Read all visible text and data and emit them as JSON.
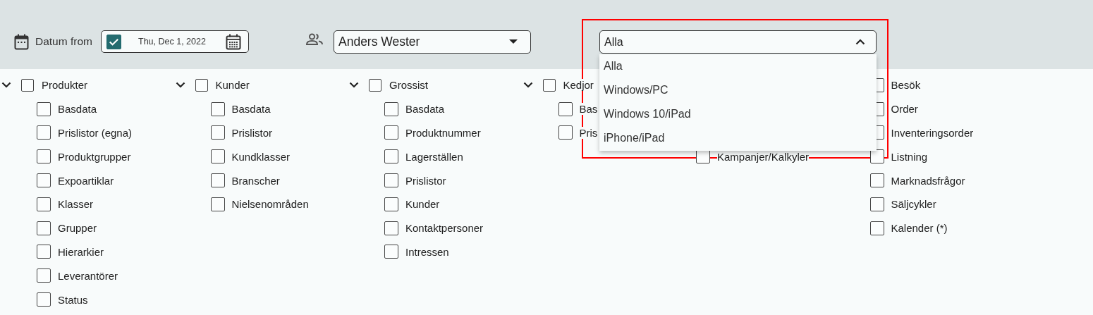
{
  "filters": {
    "date": {
      "label": "Datum from",
      "checked": true,
      "value": "Thu, Dec 1, 2022"
    },
    "person": {
      "value": "Anders Wester"
    },
    "platform": {
      "value": "Alla",
      "expanded": true,
      "options": [
        "Alla",
        "Windows/PC",
        "Windows 10/iPad",
        "iPhone/iPad"
      ]
    }
  },
  "columns": [
    {
      "kind": "group",
      "label": "Produkter",
      "expanded": true,
      "checked": false,
      "items": [
        {
          "label": "Basdata",
          "checked": false
        },
        {
          "label": "Prislistor (egna)",
          "checked": false
        },
        {
          "label": "Produktgrupper",
          "checked": false
        },
        {
          "label": "Expoartiklar",
          "checked": false
        },
        {
          "label": "Klasser",
          "checked": false
        },
        {
          "label": "Grupper",
          "checked": false
        },
        {
          "label": "Hierarkier",
          "checked": false
        },
        {
          "label": "Leverantörer",
          "checked": false
        },
        {
          "label": "Status",
          "checked": false
        }
      ]
    },
    {
      "kind": "group",
      "label": "Kunder",
      "expanded": true,
      "checked": false,
      "items": [
        {
          "label": "Basdata",
          "checked": false
        },
        {
          "label": "Prislistor",
          "checked": false
        },
        {
          "label": "Kundklasser",
          "checked": false
        },
        {
          "label": "Branscher",
          "checked": false
        },
        {
          "label": "Nielsenområden",
          "checked": false
        }
      ]
    },
    {
      "kind": "group",
      "label": "Grossist",
      "expanded": true,
      "checked": false,
      "items": [
        {
          "label": "Basdata",
          "checked": false
        },
        {
          "label": "Produktnummer",
          "checked": false
        },
        {
          "label": "Lagerställen",
          "checked": false
        },
        {
          "label": "Prislistor",
          "checked": false
        },
        {
          "label": "Kunder",
          "checked": false
        },
        {
          "label": "Kontaktpersoner",
          "checked": false
        },
        {
          "label": "Intressen",
          "checked": false
        }
      ]
    },
    {
      "kind": "group",
      "label": "Kedjor",
      "expanded": true,
      "checked": false,
      "items": [
        {
          "label": "Bas",
          "checked": false
        },
        {
          "label": "Pris",
          "checked": false
        }
      ]
    },
    {
      "kind": "list",
      "items": [
        {
          "label": "Kampanjer/Kalkyler",
          "checked": false
        }
      ]
    },
    {
      "kind": "list",
      "items": [
        {
          "label": "Besök",
          "checked": false
        },
        {
          "label": "Order",
          "checked": false
        },
        {
          "label": "Inventeringsorder",
          "checked": false
        },
        {
          "label": "Listning",
          "checked": false
        },
        {
          "label": "Marknadsfrågor",
          "checked": false
        },
        {
          "label": "Säljcykler",
          "checked": false
        },
        {
          "label": "Kalender (*)",
          "checked": false
        }
      ]
    }
  ]
}
